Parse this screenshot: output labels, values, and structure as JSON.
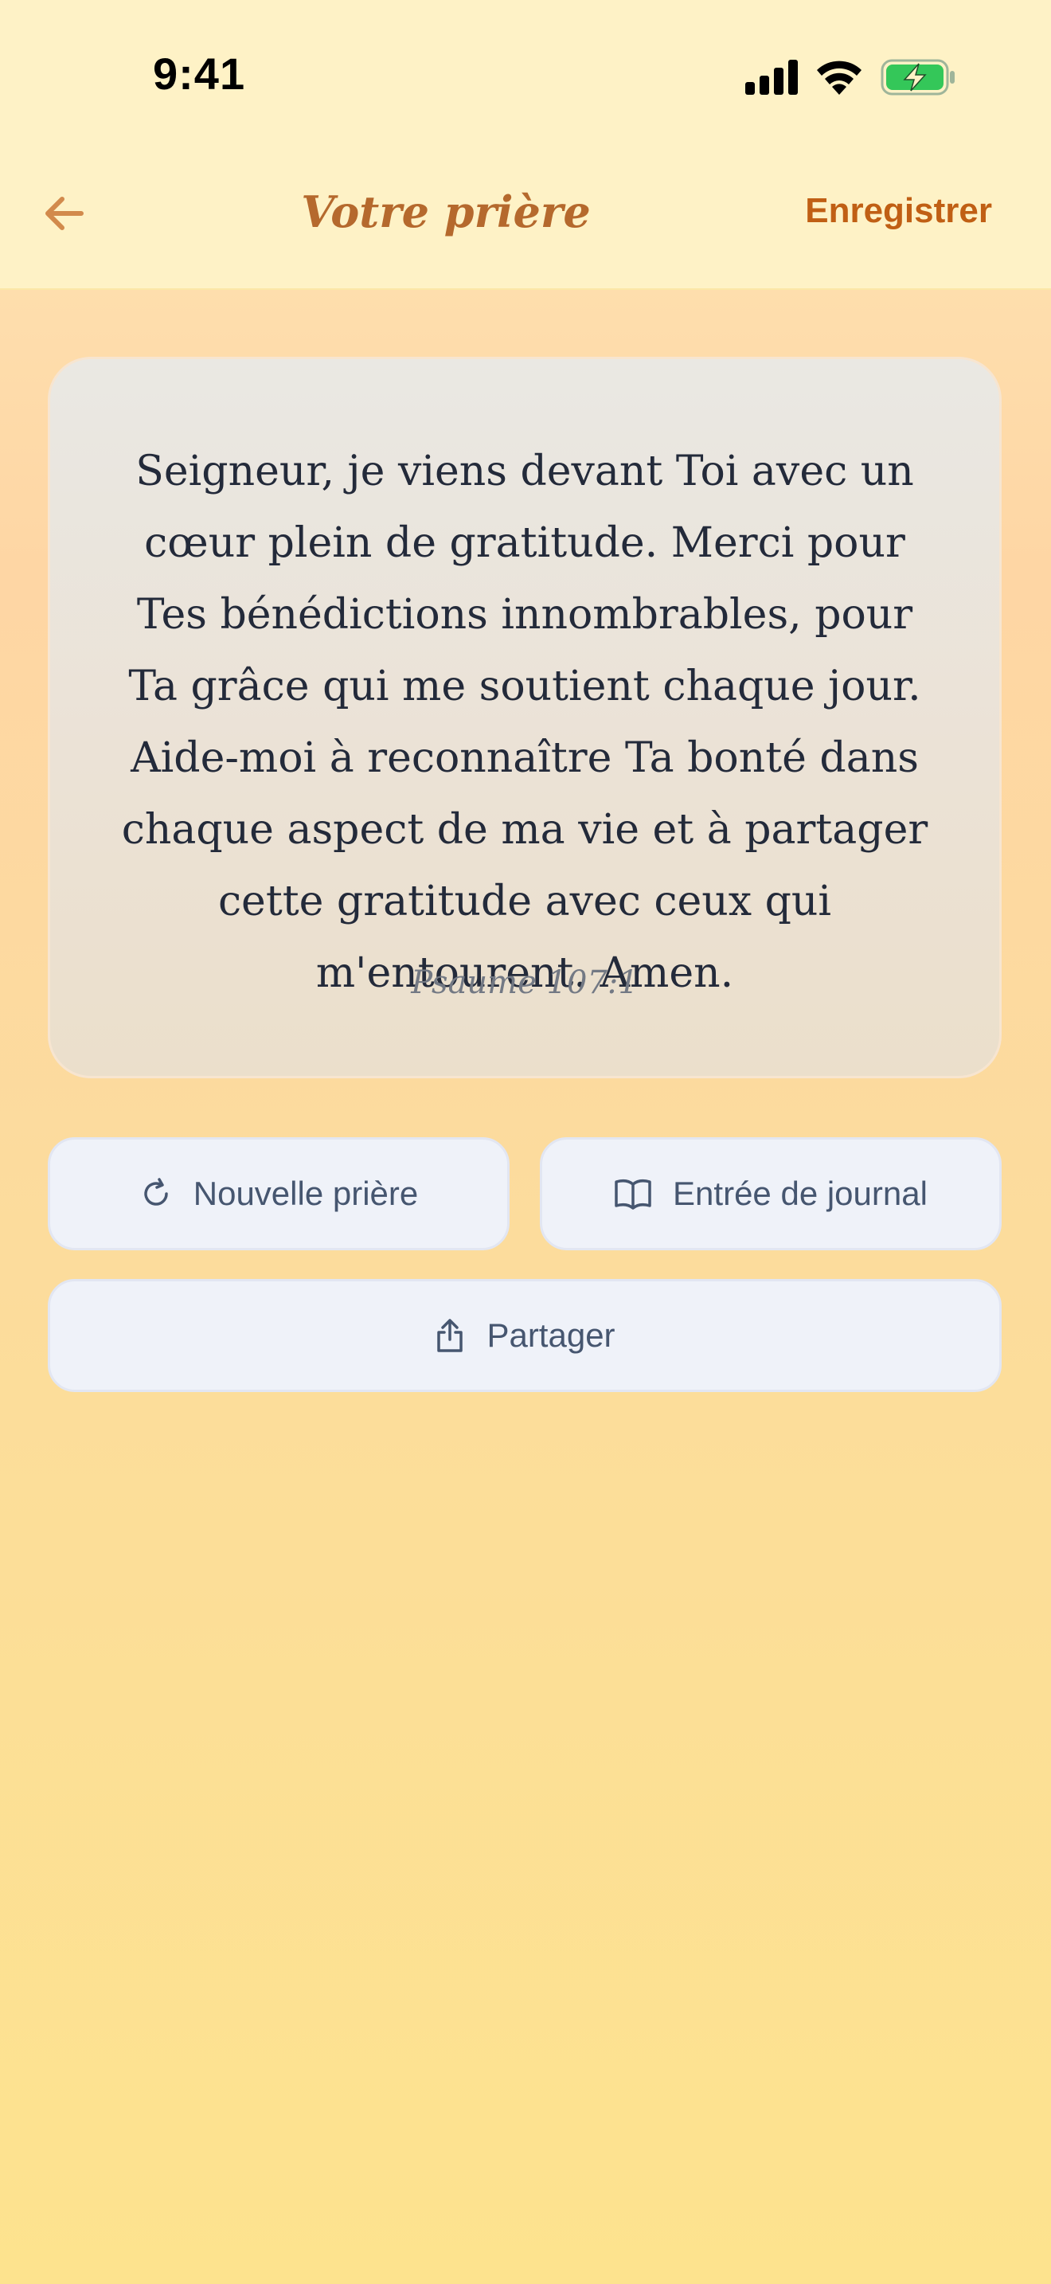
{
  "status_bar": {
    "time": "9:41",
    "icons": [
      "cellular-signal-icon",
      "wifi-icon",
      "battery-charging-icon"
    ]
  },
  "nav": {
    "back_icon": "arrow-left-icon",
    "title": "Votre prière",
    "save_label": "Enregistrer"
  },
  "prayer": {
    "text": "Seigneur, je viens devant Toi avec un cœur plein de gratitude. Merci pour Tes bénédictions innombrables, pour Ta grâce qui me soutient chaque jour. Aide-moi à reconnaître Ta bonté dans chaque aspect de ma vie et à partager cette gratitude avec ceux qui m'entourent. Amen.",
    "reference": "Psaume 107:1"
  },
  "actions": {
    "new_prayer": {
      "label": "Nouvelle prière",
      "icon": "refresh-icon"
    },
    "journal_entry": {
      "label": "Entrée de journal",
      "icon": "open-book-icon"
    },
    "share": {
      "label": "Partager",
      "icon": "share-icon"
    }
  },
  "colors": {
    "accent": "#c05f14",
    "title": "#b5692d",
    "battery": "#34c759",
    "button_text": "#465670"
  }
}
